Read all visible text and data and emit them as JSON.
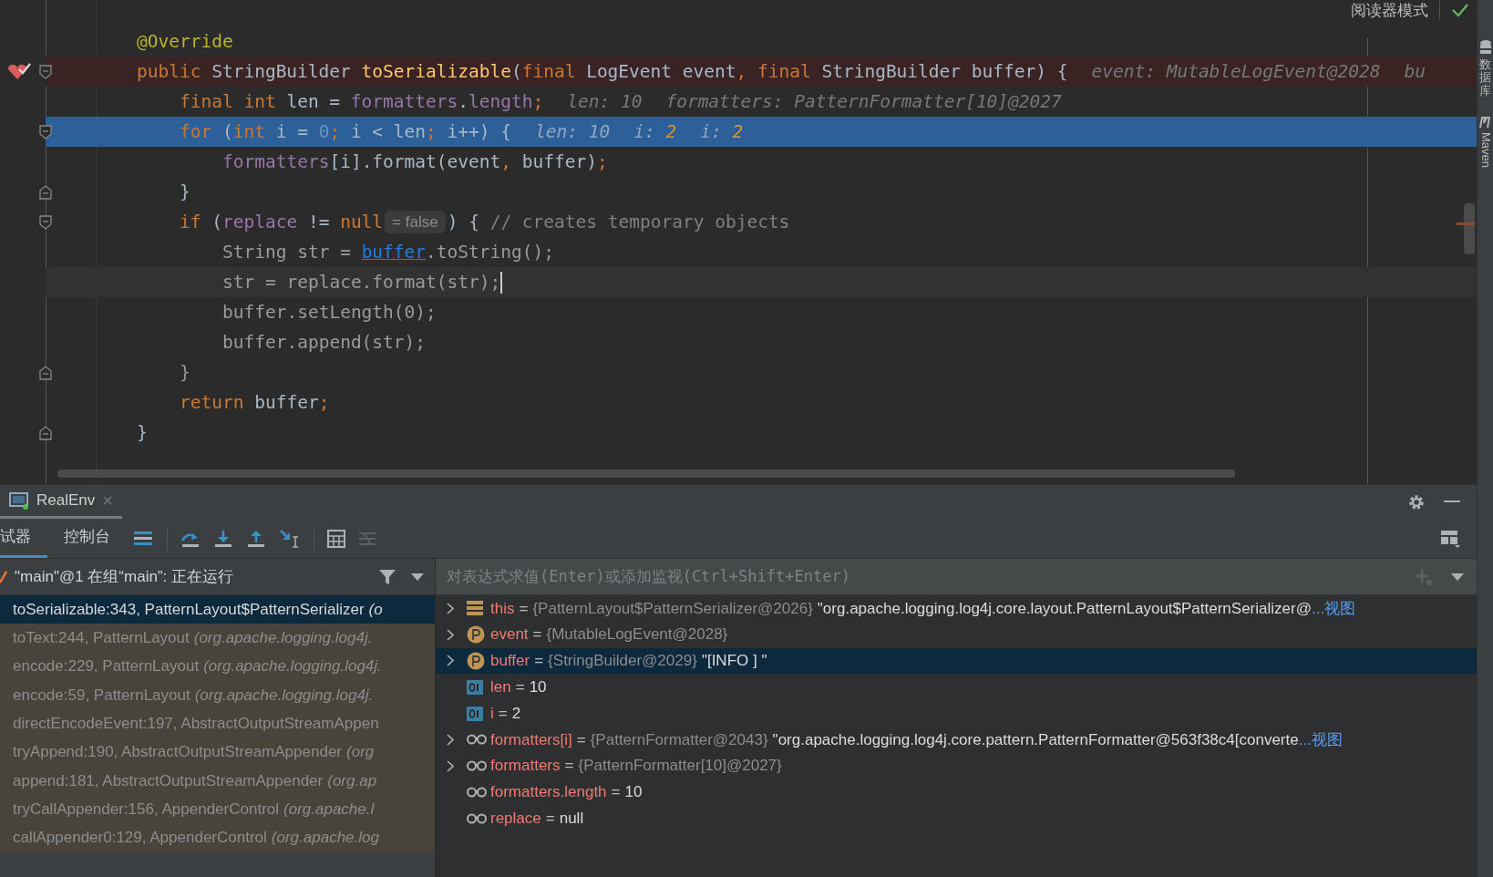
{
  "editor": {
    "reader_mode": "阅读器模式",
    "lines": [
      {
        "breakpoint": false,
        "current": false,
        "caret": false,
        "fold": false,
        "segments": [
          {
            "kind": "code",
            "tokens": [
              {
                "kind": "annotation",
                "text": "@Override"
              }
            ]
          }
        ]
      },
      {
        "breakpoint": true,
        "current": false,
        "caret": false,
        "fold": true,
        "segments": [
          {
            "kind": "code",
            "tokens": [
              {
                "kind": "keyword",
                "text": "public "
              },
              {
                "kind": "plain",
                "text": "StringBuilder "
              },
              {
                "kind": "method",
                "text": "toSerializable"
              },
              {
                "kind": "plain",
                "text": "("
              },
              {
                "kind": "keyword",
                "text": "final "
              },
              {
                "kind": "plain",
                "text": "LogEvent event"
              },
              {
                "kind": "keyword",
                "text": ", final "
              },
              {
                "kind": "plain",
                "text": "StringBuilder buffer) {"
              }
            ]
          },
          {
            "kind": "hint",
            "name": "event: ",
            "value": "MutableLogEvent@2028",
            "changed": false
          },
          {
            "kind": "hint",
            "name": "bu"
          }
        ],
        "children": [
          {
            "breakpoint": false,
            "current": false,
            "caret": false,
            "fold": false,
            "segments": [
              {
                "kind": "code",
                "tokens": [
                  {
                    "kind": "keyword",
                    "text": "final int "
                  },
                  {
                    "kind": "plain",
                    "text": "len = "
                  },
                  {
                    "kind": "field",
                    "text": "formatters"
                  },
                  {
                    "kind": "plain",
                    "text": "."
                  },
                  {
                    "kind": "field",
                    "text": "length"
                  },
                  {
                    "kind": "keyword",
                    "text": ";"
                  }
                ]
              },
              {
                "kind": "hint",
                "name": "len: ",
                "value": "10",
                "changed": false
              },
              {
                "kind": "hint",
                "name": "formatters: ",
                "value": "PatternFormatter[10]@2027",
                "changed": false
              }
            ]
          },
          {
            "breakpoint": false,
            "current": true,
            "caret": false,
            "fold": true,
            "segments": [
              {
                "kind": "code",
                "tokens": [
                  {
                    "kind": "keyword",
                    "text": "for "
                  },
                  {
                    "kind": "plain",
                    "text": "("
                  },
                  {
                    "kind": "keyword",
                    "text": "int "
                  },
                  {
                    "kind": "plain",
                    "text": "i = "
                  },
                  {
                    "kind": "number",
                    "text": "0"
                  },
                  {
                    "kind": "keyword",
                    "text": "; "
                  },
                  {
                    "kind": "plain",
                    "text": "i < len"
                  },
                  {
                    "kind": "keyword",
                    "text": "; "
                  },
                  {
                    "kind": "plain",
                    "text": "i++) {"
                  }
                ]
              },
              {
                "kind": "hint",
                "name": "len: ",
                "value": "10",
                "changed": false
              },
              {
                "kind": "hint",
                "name": "i: ",
                "value": "2",
                "changed": true
              },
              {
                "kind": "hint",
                "name": "i: ",
                "value": "2",
                "changed": true
              }
            ],
            "children": [
              {
                "breakpoint": false,
                "current": false,
                "caret": false,
                "fold": false,
                "segments": [
                  {
                    "kind": "code",
                    "tokens": [
                      {
                        "kind": "field",
                        "text": "formatters"
                      },
                      {
                        "kind": "plain",
                        "text": "[i].format(event"
                      },
                      {
                        "kind": "keyword",
                        "text": ", "
                      },
                      {
                        "kind": "plain",
                        "text": "buffer)"
                      },
                      {
                        "kind": "keyword",
                        "text": ";"
                      }
                    ]
                  }
                ]
              }
            ]
          },
          {
            "breakpoint": false,
            "current": false,
            "caret": false,
            "fold": true,
            "segments": [
              {
                "kind": "code",
                "tokens": [
                  {
                    "kind": "plain",
                    "text": "}"
                  }
                ]
              }
            ]
          },
          {
            "breakpoint": false,
            "current": false,
            "caret": false,
            "fold": true,
            "segments": [
              {
                "kind": "code",
                "tokens": [
                  {
                    "kind": "keyword",
                    "text": "if "
                  },
                  {
                    "kind": "plain",
                    "text": "("
                  },
                  {
                    "kind": "field",
                    "text": "replace "
                  },
                  {
                    "kind": "plain",
                    "text": "!= "
                  },
                  {
                    "kind": "keyword",
                    "text": "null"
                  }
                ]
              },
              {
                "kind": "chip",
                "text": "= false"
              },
              {
                "kind": "code",
                "tokens": [
                  {
                    "kind": "plain",
                    "text": ") { "
                  },
                  {
                    "kind": "comment",
                    "text": "// creates temporary objects"
                  }
                ]
              }
            ],
            "children": [
              {
                "breakpoint": false,
                "current": false,
                "caret": false,
                "fold": false,
                "segments": [
                  {
                    "kind": "code",
                    "tokens": [
                      {
                        "kind": "dim",
                        "text": "String str = "
                      },
                      {
                        "kind": "link",
                        "text": "buffer"
                      },
                      {
                        "kind": "dim",
                        "text": ".toString();"
                      }
                    ]
                  }
                ]
              },
              {
                "breakpoint": false,
                "current": false,
                "caret": true,
                "fold": false,
                "segments": [
                  {
                    "kind": "code",
                    "tokens": [
                      {
                        "kind": "dim",
                        "text": "str = replace.format(str);"
                      }
                    ]
                  }
                ]
              },
              {
                "breakpoint": false,
                "current": false,
                "caret": false,
                "fold": false,
                "segments": [
                  {
                    "kind": "code",
                    "tokens": [
                      {
                        "kind": "dim",
                        "text": "buffer.setLength(0);"
                      }
                    ]
                  }
                ]
              },
              {
                "breakpoint": false,
                "current": false,
                "caret": false,
                "fold": false,
                "segments": [
                  {
                    "kind": "code",
                    "tokens": [
                      {
                        "kind": "dim",
                        "text": "buffer.append(str);"
                      }
                    ]
                  }
                ]
              }
            ]
          },
          {
            "breakpoint": false,
            "current": false,
            "caret": false,
            "fold": true,
            "segments": [
              {
                "kind": "code",
                "tokens": [
                  {
                    "kind": "dim",
                    "text": "}"
                  }
                ]
              }
            ]
          },
          {
            "breakpoint": false,
            "current": false,
            "caret": false,
            "fold": false,
            "segments": [
              {
                "kind": "code",
                "tokens": [
                  {
                    "kind": "keyword",
                    "text": "return "
                  },
                  {
                    "kind": "plain",
                    "text": "buffer"
                  },
                  {
                    "kind": "keyword",
                    "text": ";"
                  }
                ]
              }
            ]
          }
        ]
      },
      {
        "breakpoint": false,
        "current": false,
        "caret": false,
        "fold": true,
        "segments": [
          {
            "kind": "code",
            "tokens": [
              {
                "kind": "plain",
                "text": "}"
              }
            ]
          }
        ]
      }
    ]
  },
  "right_strip": [
    {
      "kind": "database",
      "label": "数据库"
    },
    {
      "kind": "maven",
      "label": "Maven"
    }
  ],
  "debug": {
    "run_tab": "RealEnv",
    "tabs": [
      {
        "label": "试器",
        "selected": true
      },
      {
        "label": "控制台",
        "selected": false
      }
    ],
    "thread": "\"main\"@1 在组“main”: 正在运行",
    "frames": [
      {
        "method": "toSerializable:343, PatternLayout$PatternSerializer",
        "package": "(o",
        "selected": true,
        "library": false
      },
      {
        "method": "toText:244, PatternLayout",
        "package": "(org.apache.logging.log4j.",
        "selected": false,
        "library": true
      },
      {
        "method": "encode:229, PatternLayout",
        "package": "(org.apache.logging.log4j.",
        "selected": false,
        "library": true
      },
      {
        "method": "encode:59, PatternLayout",
        "package": "(org.apache.logging.log4j.",
        "selected": false,
        "library": true
      },
      {
        "method": "directEncodeEvent:197, AbstractOutputStreamAppen",
        "selected": false,
        "library": true
      },
      {
        "method": "tryAppend:190, AbstractOutputStreamAppender",
        "package": "(org",
        "selected": false,
        "library": true
      },
      {
        "method": "append:181, AbstractOutputStreamAppender",
        "package": "(org.ap",
        "selected": false,
        "library": true
      },
      {
        "method": "tryCallAppender:156, AppenderControl",
        "package": "(org.apache.l",
        "selected": false,
        "library": true
      },
      {
        "method": "callAppender0:129, AppenderControl",
        "package": "(org.apache.log",
        "selected": false,
        "library": true
      }
    ],
    "eval_placeholder": "对表达式求值(Enter)或添加监视(Ctrl+Shift+Enter)",
    "variables": [
      {
        "kind": "object",
        "expandable": true,
        "selected": false,
        "name": "this",
        "operator": "=",
        "type": "{PatternLayout$PatternSerializer@2026}",
        "value": "\"org.apache.logging.log4j.core.layout.PatternLayout$PatternSerializer@",
        "link": "...视图"
      },
      {
        "kind": "param",
        "expandable": true,
        "selected": false,
        "name": "event",
        "operator": "=",
        "type": "{MutableLogEvent@2028}"
      },
      {
        "kind": "param",
        "expandable": true,
        "selected": true,
        "name": "buffer",
        "operator": "=",
        "type": "{StringBuilder@2029}",
        "value": "\"[INFO ] \""
      },
      {
        "kind": "primitive",
        "expandable": false,
        "selected": false,
        "name": "len",
        "operator": "=",
        "value": "10"
      },
      {
        "kind": "primitive",
        "expandable": false,
        "selected": false,
        "name": "i",
        "operator": "=",
        "value": "2"
      },
      {
        "kind": "watch",
        "expandable": true,
        "selected": false,
        "name": "formatters[i]",
        "operator": "=",
        "type": "{PatternFormatter@2043}",
        "value": "\"org.apache.logging.log4j.core.pattern.PatternFormatter@563f38c4[converte",
        "link": "...视图"
      },
      {
        "kind": "watch",
        "expandable": true,
        "selected": false,
        "name": "formatters",
        "operator": "=",
        "type": "{PatternFormatter[10]@2027}"
      },
      {
        "kind": "watch",
        "expandable": false,
        "selected": false,
        "name": "formatters.length",
        "operator": "=",
        "value": "10"
      },
      {
        "kind": "watch",
        "expandable": false,
        "selected": false,
        "name": "replace",
        "operator": "=",
        "value": "null"
      }
    ]
  }
}
